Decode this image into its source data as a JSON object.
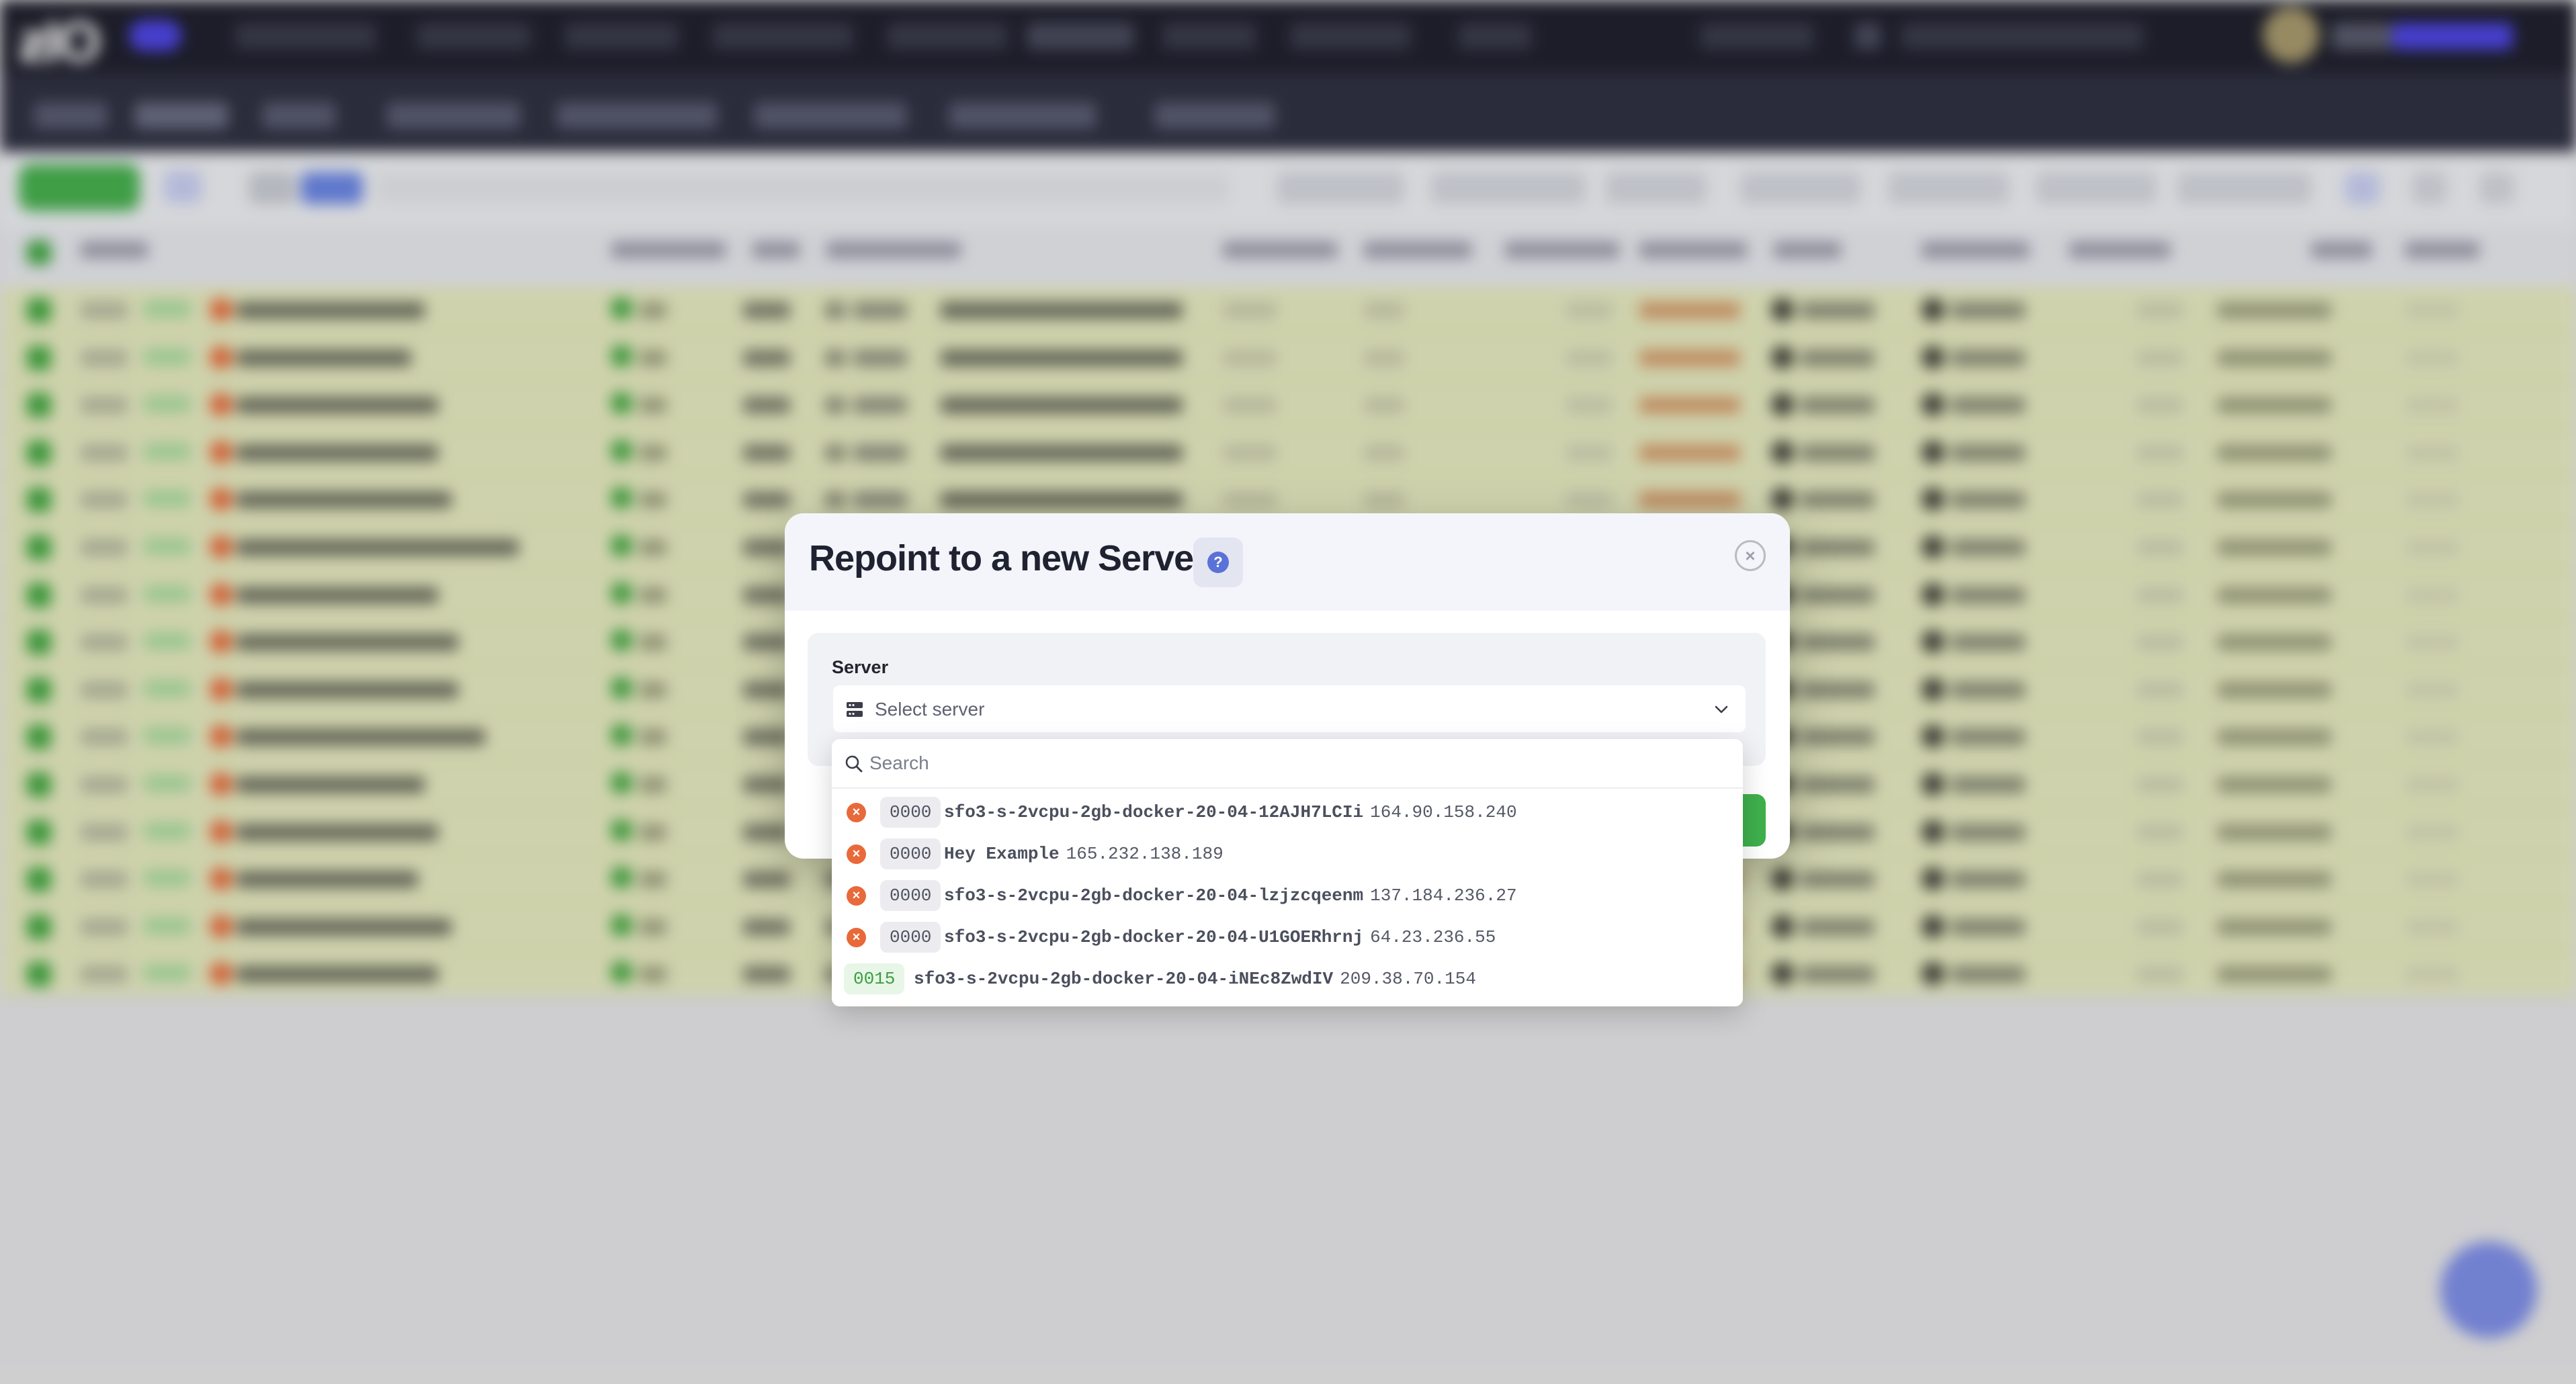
{
  "modal": {
    "title": "Repoint to a new Server",
    "help_glyph": "?",
    "close_glyph": "×",
    "field_label": "Server",
    "select": {
      "placeholder": "Select server",
      "icon": "server-icon",
      "chevron": "chevron-down-icon"
    },
    "dropdown": {
      "search_placeholder": "Search",
      "options": [
        {
          "status": "error",
          "status_glyph": "×",
          "code": "0000",
          "name": "sfo3-s-2vcpu-2gb-docker-20-04-12AJH7LCIi",
          "ip": "164.90.158.240"
        },
        {
          "status": "error",
          "status_glyph": "×",
          "code": "0000",
          "name": "Hey Example",
          "ip": "165.232.138.189"
        },
        {
          "status": "error",
          "status_glyph": "×",
          "code": "0000",
          "name": "sfo3-s-2vcpu-2gb-docker-20-04-lzjzcqeenm",
          "ip": "137.184.236.27"
        },
        {
          "status": "error",
          "status_glyph": "×",
          "code": "0000",
          "name": "sfo3-s-2vcpu-2gb-docker-20-04-U1GOERhrnj",
          "ip": "64.23.236.55"
        },
        {
          "status": "ok",
          "status_glyph": "",
          "code": "0015",
          "name": "sfo3-s-2vcpu-2gb-docker-20-04-iNEc8ZwdIV",
          "ip": "209.38.70.154"
        }
      ]
    }
  },
  "colors": {
    "error": "#e8693a",
    "ok": "#3a9e41",
    "row_highlight": "#e7ebc1",
    "accent": "#4f46e5"
  }
}
